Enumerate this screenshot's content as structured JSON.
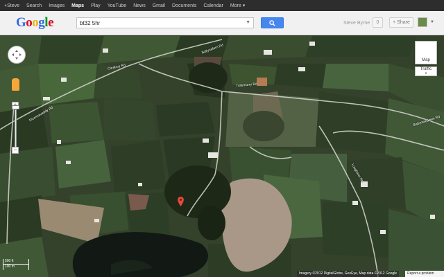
{
  "google_bar": {
    "items": [
      {
        "label": "+Steve",
        "active": false
      },
      {
        "label": "Search",
        "active": false
      },
      {
        "label": "Images",
        "active": false
      },
      {
        "label": "Maps",
        "active": true
      },
      {
        "label": "Play",
        "active": false
      },
      {
        "label": "YouTube",
        "active": false
      },
      {
        "label": "News",
        "active": false
      },
      {
        "label": "Gmail",
        "active": false
      },
      {
        "label": "Documents",
        "active": false
      },
      {
        "label": "Calendar",
        "active": false
      },
      {
        "label": "More ▾",
        "active": false
      }
    ]
  },
  "header": {
    "logo_letters": [
      {
        "ch": "G",
        "color": "#3369e8"
      },
      {
        "ch": "o",
        "color": "#d50f25"
      },
      {
        "ch": "o",
        "color": "#eeb211"
      },
      {
        "ch": "g",
        "color": "#3369e8"
      },
      {
        "ch": "l",
        "color": "#009925"
      },
      {
        "ch": "e",
        "color": "#d50f25"
      }
    ],
    "search_value": "bt32 5hr",
    "user_name": "Steve Byrne",
    "notification_count": "0",
    "share_label": "+ Share"
  },
  "map": {
    "road_labels": [
      {
        "text": "Ballynafern Rd"
      },
      {
        "text": "Cleaboy Rd"
      },
      {
        "text": "Tullymurry Rd"
      },
      {
        "text": "Drumnavaddy Rd"
      },
      {
        "text": "Ballymacdown Rd"
      },
      {
        "text": "Loughans Rd"
      }
    ],
    "map_type_label": "Map",
    "traffic_label": "Traffic",
    "scale_top": "500 ft",
    "scale_bottom": "100 m",
    "attribution": "Imagery ©2012 DigitalGlobe, GeoEye, Map data ©2012 Google",
    "report_label": "Report a problem"
  }
}
